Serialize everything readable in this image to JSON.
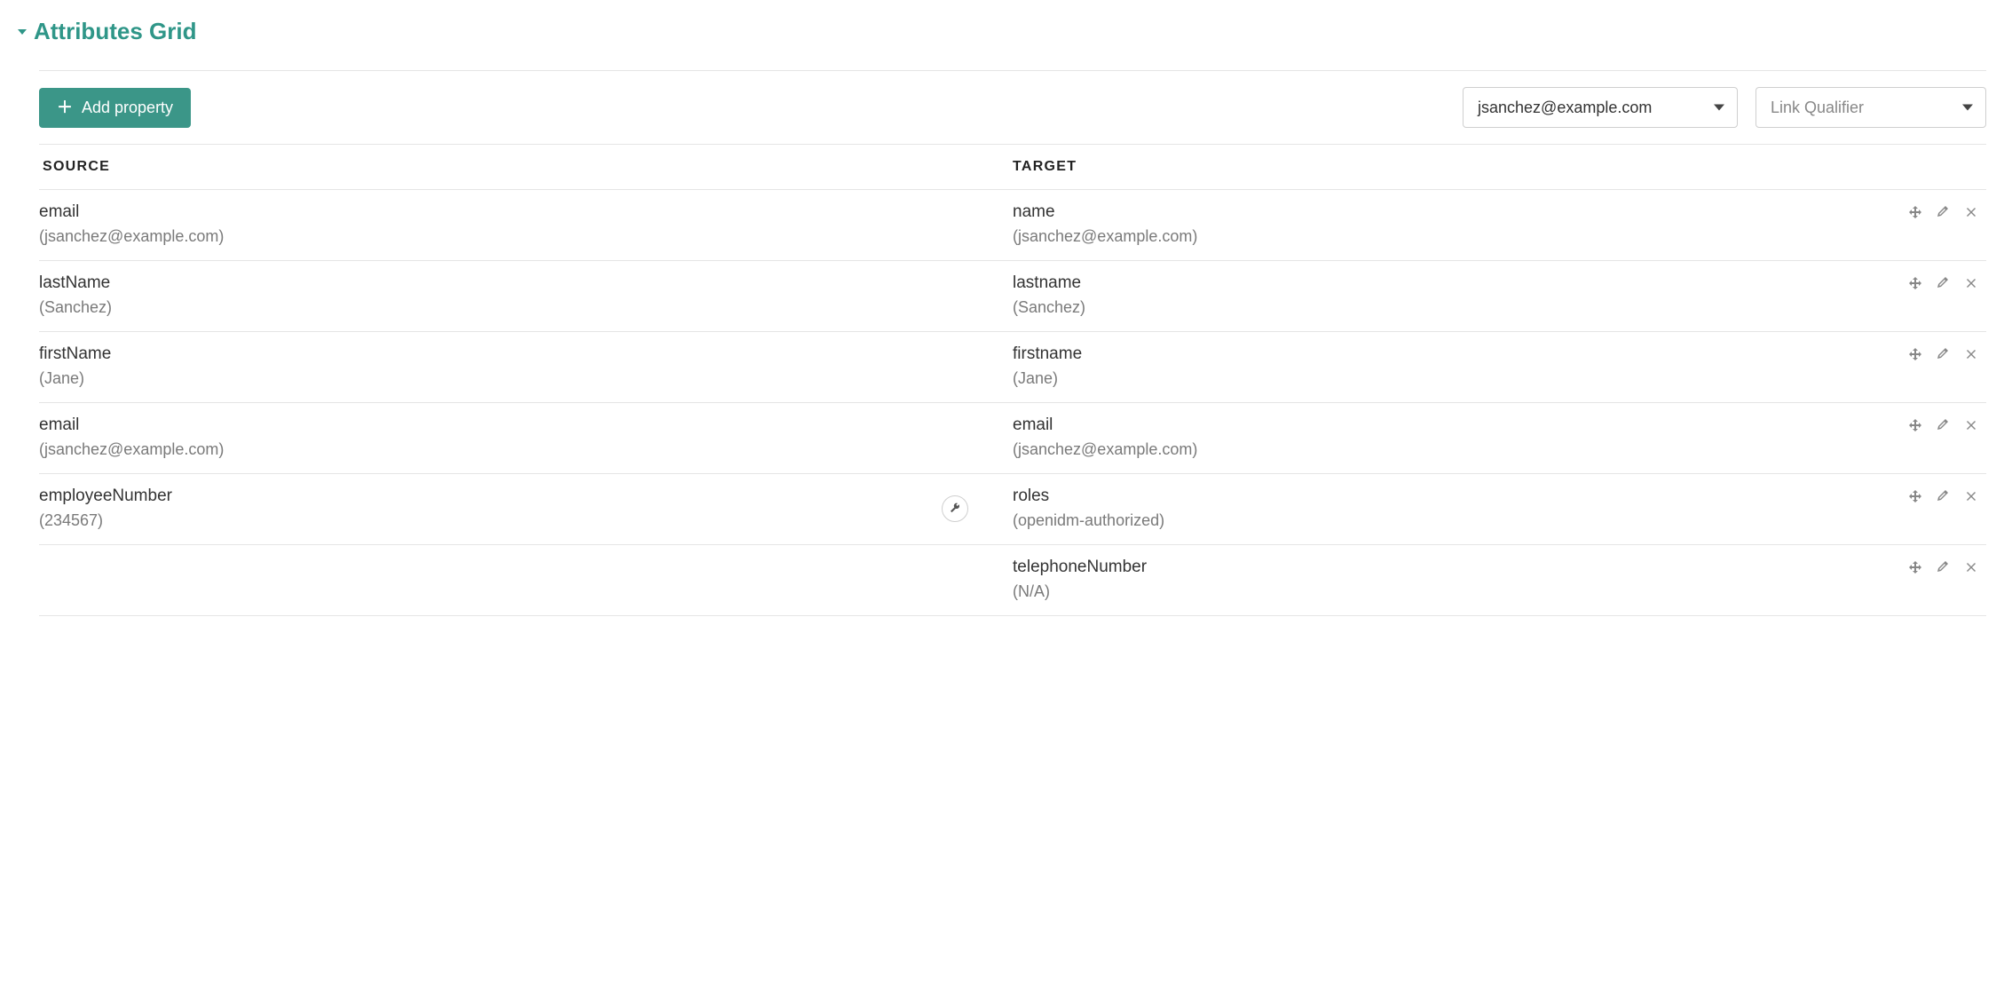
{
  "section": {
    "title": "Attributes Grid"
  },
  "toolbar": {
    "add_label": "Add property",
    "user_select": "jsanchez@example.com",
    "link_qualifier_placeholder": "Link Qualifier"
  },
  "grid": {
    "headers": {
      "source": "Source",
      "target": "Target"
    },
    "rows": [
      {
        "source": {
          "name": "email",
          "value": "(jsanchez@example.com)"
        },
        "target": {
          "name": "name",
          "value": "(jsanchez@example.com)"
        },
        "has_transform": false
      },
      {
        "source": {
          "name": "lastName",
          "value": "(Sanchez)"
        },
        "target": {
          "name": "lastname",
          "value": "(Sanchez)"
        },
        "has_transform": false
      },
      {
        "source": {
          "name": "firstName",
          "value": "(Jane)"
        },
        "target": {
          "name": "firstname",
          "value": "(Jane)"
        },
        "has_transform": false
      },
      {
        "source": {
          "name": "email",
          "value": "(jsanchez@example.com)"
        },
        "target": {
          "name": "email",
          "value": "(jsanchez@example.com)"
        },
        "has_transform": false
      },
      {
        "source": {
          "name": "employeeNumber",
          "value": "(234567)"
        },
        "target": {
          "name": "roles",
          "value": "(openidm-authorized)"
        },
        "has_transform": true
      },
      {
        "source": {
          "name": "",
          "value": ""
        },
        "target": {
          "name": "telephoneNumber",
          "value": "(N/A)"
        },
        "has_transform": false
      }
    ]
  }
}
